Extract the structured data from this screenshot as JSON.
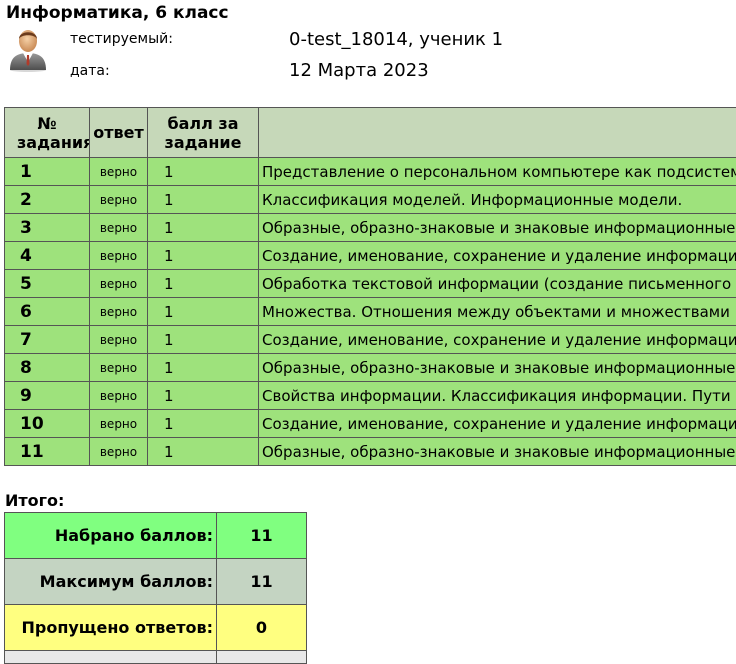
{
  "header": {
    "title": "Информатика, 6 класс",
    "student_label": "тестируемый:",
    "student_value": "0-test_18014, ученик 1",
    "date_label": "дата:",
    "date_value": "12 Марта 2023",
    "avatar_icon": "user-avatar-icon"
  },
  "table": {
    "col_num": "№ задания",
    "col_answer": "ответ",
    "col_score": "балл за задание",
    "col_topic": "",
    "rows": [
      {
        "num": "1",
        "answer": "верно",
        "score": "1",
        "topic": "Представление о персональном компьютере как подсистеме"
      },
      {
        "num": "2",
        "answer": "верно",
        "score": "1",
        "topic": "Классификация моделей. Информационные модели."
      },
      {
        "num": "3",
        "answer": "верно",
        "score": "1",
        "topic": "Образные, образно-знаковые и знаковые информационные модели"
      },
      {
        "num": "4",
        "answer": "верно",
        "score": "1",
        "topic": "Создание, именование, сохранение и удаление информационных объектов"
      },
      {
        "num": "5",
        "answer": "верно",
        "score": "1",
        "topic": "Обработка текстовой информации (создание письменного текста)"
      },
      {
        "num": "6",
        "answer": "верно",
        "score": "1",
        "topic": "Множества. Отношения между объектами и множествами"
      },
      {
        "num": "7",
        "answer": "верно",
        "score": "1",
        "topic": "Создание, именование, сохранение и удаление информационных объектов"
      },
      {
        "num": "8",
        "answer": "верно",
        "score": "1",
        "topic": "Образные, образно-знаковые и знаковые информационные модели"
      },
      {
        "num": "9",
        "answer": "верно",
        "score": "1",
        "topic": "Свойства информации. Классификация информации. Пути"
      },
      {
        "num": "10",
        "answer": "верно",
        "score": "1",
        "topic": "Создание, именование, сохранение и удаление информационных объектов"
      },
      {
        "num": "11",
        "answer": "верно",
        "score": "1",
        "topic": "Образные, образно-знаковые и знаковые информационные модели"
      }
    ]
  },
  "summary": {
    "heading": "Итого:",
    "got_label": "Набрано баллов:",
    "got_value": "11",
    "max_label": "Максимум баллов:",
    "max_value": "11",
    "missed_label": "Пропущено ответов:",
    "missed_value": "0"
  },
  "colors": {
    "header_bg": "#c6d8b9",
    "row_bg": "#9ee27c",
    "got_bg": "#80ff80",
    "max_bg": "#c4d4c2",
    "missed_bg": "#ffff80"
  }
}
